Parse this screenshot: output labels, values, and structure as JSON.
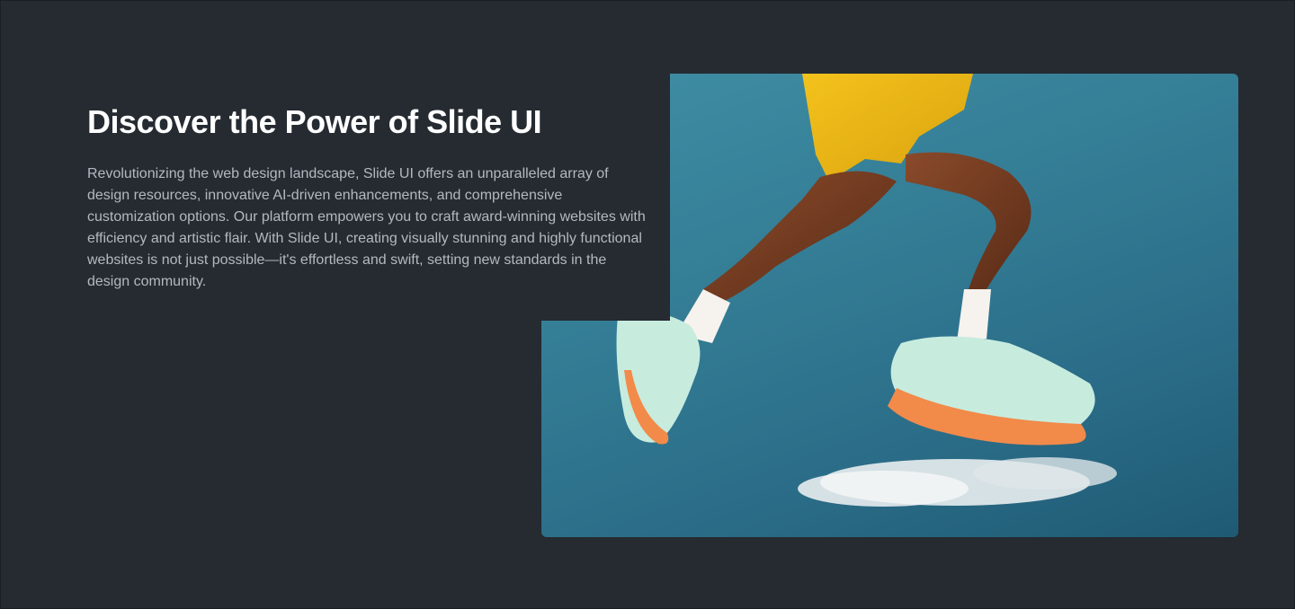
{
  "section": {
    "title": "Discover the Power of Slide UI",
    "description": "Revolutionizing the web design landscape, Slide UI offers an unparalleled array of design resources, innovative AI-driven enhancements, and comprehensive customization options. Our platform empowers you to craft award-winning websites with efficiency and artistic flair. With Slide UI, creating visually stunning and highly functional websites is not just possible—it's effortless and swift, setting new standards in the design community."
  },
  "image": {
    "alt": "Athlete legs mid-jump wearing yellow shorts and mint and orange running shoes against a blue sky"
  },
  "colors": {
    "background": "#252b31",
    "heading": "#ffffff",
    "body": "#b3b9bf",
    "sky": "#357f97"
  }
}
